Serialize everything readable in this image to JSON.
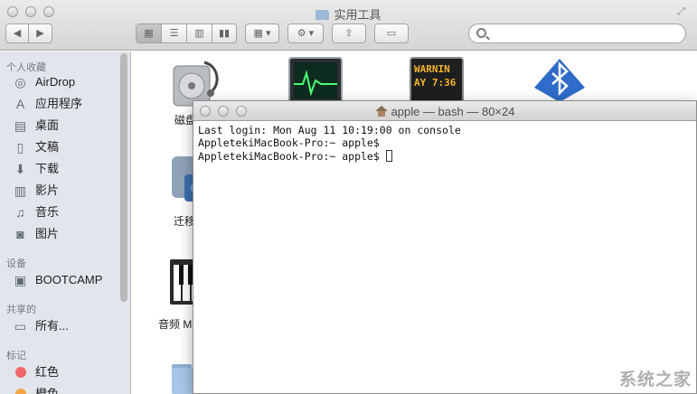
{
  "finder": {
    "title": "实用工具",
    "sidebar": {
      "sections": [
        {
          "header": "个人收藏",
          "items": [
            "AirDrop",
            "应用程序",
            "桌面",
            "文稿",
            "下载",
            "影片",
            "音乐",
            "图片"
          ]
        },
        {
          "header": "设备",
          "items": [
            "BOOTCAMP"
          ]
        },
        {
          "header": "共享的",
          "items": [
            "所有..."
          ]
        },
        {
          "header": "标记",
          "items": [
            "红色",
            "橙色"
          ]
        }
      ]
    },
    "content": {
      "labels": [
        "磁盘",
        "迁移",
        "音频 M"
      ],
      "console_text": "WARNIN\nAY 7:36"
    },
    "colors": {
      "red_tag": "#f2676a",
      "orange_tag": "#f5a545"
    }
  },
  "terminal": {
    "title": "apple — bash — 80×24",
    "lines": [
      "Last login: Mon Aug 11 10:19:00 on console",
      "AppletekiMacBook-Pro:~ apple$",
      "AppletekiMacBook-Pro:~ apple$ "
    ]
  },
  "watermark": "系统之家"
}
